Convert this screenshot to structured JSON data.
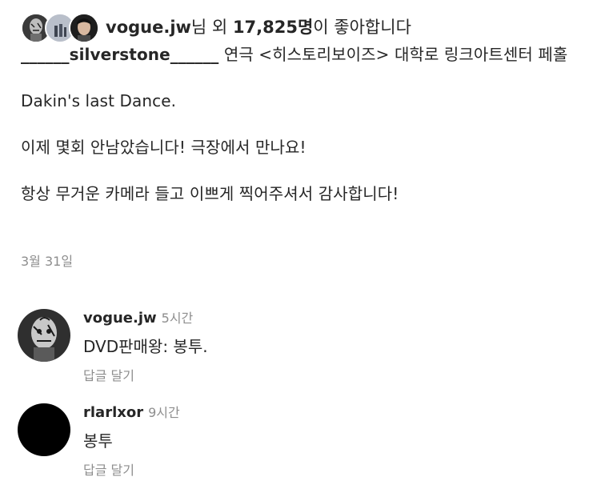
{
  "likes": {
    "username": "vogue.jw",
    "suffix": "님 외",
    "count": "17,825명",
    "after": "이 좋아합니다"
  },
  "post": {
    "author": "______silverstone______",
    "caption_line1": " 연극 <히스토리보이즈> 대학로 링크아트센터 페홀",
    "caption_line2": "Dakin's last Dance.",
    "caption_line3": "이제 몇회 안남았습니다! 극장에서 만나요!",
    "caption_line4": "항상 무거운 카메라 들고 이쁘게 찍어주셔서 감사합니다!",
    "date": "3월 31일"
  },
  "comments": [
    {
      "username": "vogue.jw",
      "time": "5시간",
      "text": "DVD판매왕: 봉투.",
      "reply_label": "답글 달기"
    },
    {
      "username": "rlarlxor",
      "time": "9시간",
      "text": "봉투",
      "reply_label": "답글 달기"
    }
  ],
  "colors": {
    "text": "#262626",
    "secondary": "#8e8e8e",
    "background": "#ffffff"
  }
}
